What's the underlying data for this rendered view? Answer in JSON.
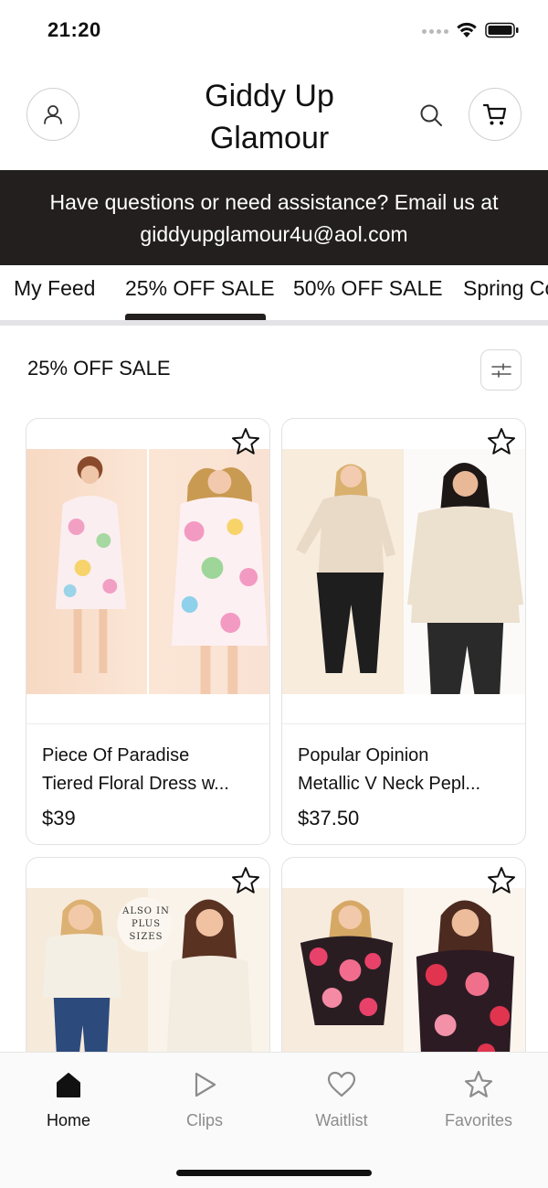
{
  "status_bar": {
    "time": "21:20"
  },
  "header": {
    "brand_line1": "Giddy Up",
    "brand_line2": "Glamour"
  },
  "banner": {
    "line1": "Have questions or need assistance? Email us at",
    "line2": "giddyupglamour4u@aol.com"
  },
  "tabs": [
    {
      "label": "My Feed",
      "active": false
    },
    {
      "label": "25% OFF SALE",
      "active": true
    },
    {
      "label": "50% OFF SALE",
      "active": false
    },
    {
      "label": "Spring Collection",
      "active": false
    }
  ],
  "section": {
    "title": "25% OFF SALE"
  },
  "products": [
    {
      "name_line1": "Piece Of Paradise",
      "name_line2": "Tiered Floral Dress w...",
      "price": "$39"
    },
    {
      "name_line1": "Popular Opinion",
      "name_line2": "Metallic V Neck Pepl...",
      "price": "$37.50"
    },
    {
      "badge_line1": "ALSO IN",
      "badge_line2": "PLUS",
      "badge_line3": "SIZES"
    },
    {}
  ],
  "bottom_nav": [
    {
      "label": "Home",
      "icon": "home-icon",
      "active": true
    },
    {
      "label": "Clips",
      "icon": "play-icon",
      "active": false
    },
    {
      "label": "Waitlist",
      "icon": "heart-icon",
      "active": false
    },
    {
      "label": "Favorites",
      "icon": "star-icon",
      "active": false
    }
  ],
  "colors": {
    "banner_bg": "#231f1e",
    "tab_indicator": "#231f1e",
    "nav_inactive": "#8c8c8c"
  }
}
